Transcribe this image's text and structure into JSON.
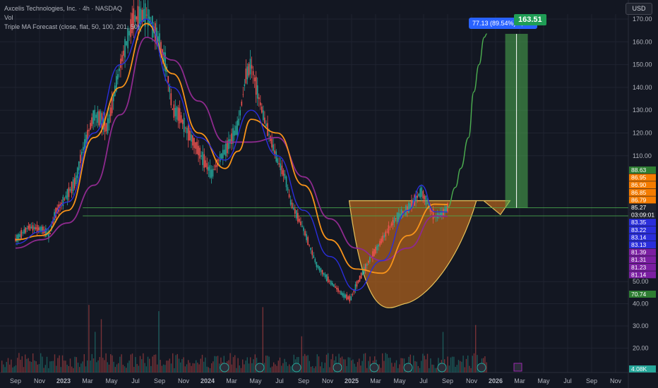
{
  "header": {
    "title": "Axcelis Technologies, Inc. · 4h · NASDAQ",
    "indicator_vol": "Vol",
    "indicator_ma": "Triple MA Forecast (close, flat, 50, 100, 201, 50)",
    "currency": "USD"
  },
  "measure_label": "77.13 (89.54%) 7,713",
  "target_label": "163.51",
  "colors": {
    "background": "#131722",
    "up": "#26a69a",
    "down": "#ef5350",
    "ma_blue": "#2a2edb",
    "ma_orange": "#f7931a",
    "ma_purple": "#8e2a8e",
    "pattern_fill": "#b5651d",
    "forecast": "#4caf50"
  },
  "chart_data": {
    "type": "line",
    "x_ticks": [
      "Sep",
      "Nov",
      "2023",
      "Mar",
      "May",
      "Jul",
      "Sep",
      "Nov",
      "2024",
      "Mar",
      "May",
      "Jul",
      "Sep",
      "Nov",
      "2025",
      "Mar",
      "May",
      "Jul",
      "Sep",
      "Nov",
      "2026",
      "Mar",
      "May",
      "Jul",
      "Sep",
      "Nov"
    ],
    "y_ticks": [
      170,
      160,
      150,
      140,
      130,
      120,
      110,
      50,
      40,
      30,
      20
    ],
    "ylim": [
      17,
      176
    ],
    "price_path": [
      [
        0,
        70
      ],
      [
        1,
        76
      ],
      [
        2,
        75
      ],
      [
        2.6,
        72
      ],
      [
        3,
        82
      ],
      [
        4,
        92
      ],
      [
        4.6,
        98
      ],
      [
        5,
        110
      ],
      [
        6,
        128
      ],
      [
        6.5,
        126
      ],
      [
        7,
        122
      ],
      [
        8,
        150
      ],
      [
        9,
        170
      ],
      [
        10,
        172
      ],
      [
        11,
        160
      ],
      [
        11.5,
        150
      ],
      [
        12,
        130
      ],
      [
        12.5,
        128
      ],
      [
        13,
        122
      ],
      [
        14,
        112
      ],
      [
        15,
        101
      ],
      [
        15.5,
        108
      ],
      [
        16,
        112
      ],
      [
        17,
        123
      ],
      [
        17.6,
        145
      ],
      [
        18,
        150
      ],
      [
        18.6,
        135
      ],
      [
        19,
        126
      ],
      [
        20,
        108
      ],
      [
        20.6,
        100
      ],
      [
        21,
        88
      ],
      [
        22,
        75
      ],
      [
        23,
        58
      ],
      [
        24,
        50
      ],
      [
        25,
        44
      ],
      [
        25.6,
        42
      ],
      [
        26,
        48
      ],
      [
        27,
        60
      ],
      [
        28,
        70
      ],
      [
        29,
        80
      ],
      [
        30,
        85
      ],
      [
        31,
        93
      ],
      [
        32,
        81
      ],
      [
        32.5,
        82
      ],
      [
        33,
        85.27
      ]
    ],
    "ma_fast": [
      [
        0,
        68
      ],
      [
        2,
        74
      ],
      [
        4,
        88
      ],
      [
        6,
        120
      ],
      [
        8,
        150
      ],
      [
        10,
        170
      ],
      [
        12,
        140
      ],
      [
        14,
        118
      ],
      [
        16,
        108
      ],
      [
        18,
        130
      ],
      [
        20,
        110
      ],
      [
        22,
        84
      ],
      [
        24,
        62
      ],
      [
        26,
        46
      ],
      [
        28,
        60
      ],
      [
        30,
        84
      ],
      [
        31,
        96
      ],
      [
        32,
        83.35
      ],
      [
        33,
        83.22
      ]
    ],
    "ma_mid": [
      [
        0,
        70
      ],
      [
        2,
        72
      ],
      [
        4,
        84
      ],
      [
        6,
        118
      ],
      [
        8,
        140
      ],
      [
        10,
        168
      ],
      [
        12,
        146
      ],
      [
        14,
        120
      ],
      [
        16,
        104
      ],
      [
        17,
        112
      ],
      [
        18,
        126
      ],
      [
        20,
        120
      ],
      [
        22,
        96
      ],
      [
        24,
        70
      ],
      [
        26,
        56
      ],
      [
        28,
        54
      ],
      [
        30,
        72
      ],
      [
        32,
        86.95
      ],
      [
        33,
        86.79
      ]
    ],
    "ma_slow": [
      [
        0,
        66
      ],
      [
        2,
        70
      ],
      [
        4,
        78
      ],
      [
        6,
        96
      ],
      [
        8,
        128
      ],
      [
        10,
        162
      ],
      [
        12,
        152
      ],
      [
        14,
        134
      ],
      [
        16,
        116
      ],
      [
        18,
        116
      ],
      [
        20,
        118
      ],
      [
        22,
        100
      ],
      [
        24,
        80
      ],
      [
        26,
        66
      ],
      [
        28,
        60
      ],
      [
        30,
        66
      ],
      [
        32,
        81.39
      ],
      [
        33,
        81.14
      ]
    ],
    "forecast_path": [
      [
        33,
        85.27
      ],
      [
        33.6,
        95
      ],
      [
        34,
        104
      ],
      [
        34.6,
        118
      ],
      [
        35,
        138
      ],
      [
        35.4,
        150
      ],
      [
        35.8,
        162
      ],
      [
        36,
        163.51
      ]
    ],
    "cup_rim": 88.63,
    "cup_bottom": 40,
    "support_lines": [
      85.27,
      81.39
    ],
    "projection_box": {
      "from": 85.27,
      "to": 163.51
    },
    "stop_box": {
      "from": 82.3,
      "to": 85.27
    },
    "right_labels": [
      {
        "value": "88.63",
        "color": "#2e7d32"
      },
      {
        "value": "86.95",
        "color": "#f57c00"
      },
      {
        "value": "86.90",
        "color": "#f57c00"
      },
      {
        "value": "86.85",
        "color": "#f57c00"
      },
      {
        "value": "86.79",
        "color": "#f57c00"
      },
      {
        "value": "85.27",
        "color": "#1e222d"
      },
      {
        "value": "03:09:01",
        "color": "#1e222d"
      },
      {
        "value": "83.35",
        "color": "#2a2edb"
      },
      {
        "value": "83.22",
        "color": "#2a2edb"
      },
      {
        "value": "83.14",
        "color": "#2a2edb"
      },
      {
        "value": "83.13",
        "color": "#2a2edb"
      },
      {
        "value": "81.39",
        "color": "#7b1fa2"
      },
      {
        "value": "81.31",
        "color": "#7b1fa2"
      },
      {
        "value": "81.23",
        "color": "#7b1fa2"
      },
      {
        "value": "81.14",
        "color": "#7b1fa2"
      },
      {
        "value": "70.74",
        "color": "#2e7d32"
      },
      {
        "value": "4.08K",
        "color": "#26a69a"
      }
    ]
  }
}
